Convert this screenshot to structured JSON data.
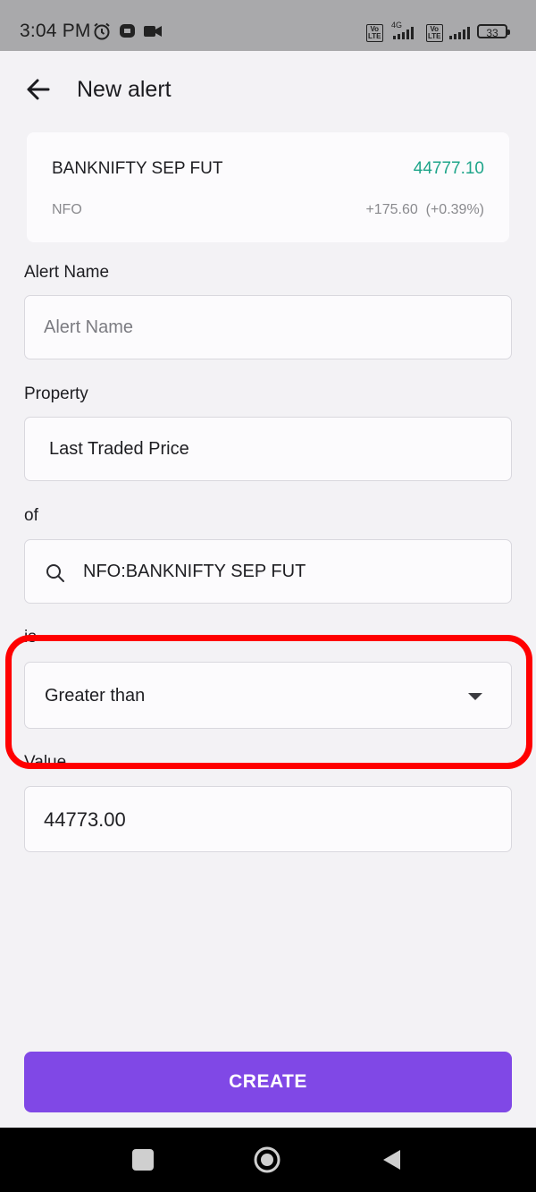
{
  "status_bar": {
    "time": "3:04 PM",
    "network": "4G",
    "volte_label": "Vo LTE",
    "battery": "33",
    "icons": [
      "alarm-icon",
      "message-icon",
      "video-icon",
      "volte-icon",
      "signal-icon",
      "battery-icon"
    ]
  },
  "header": {
    "title": "New alert",
    "back_icon": "arrow-left-icon"
  },
  "instrument": {
    "name": "BANKNIFTY SEP FUT",
    "exchange": "NFO",
    "ltp": "44777.10",
    "change": "+175.60  (+0.39%)",
    "ltp_color": "#1fa58a"
  },
  "form": {
    "alert_name": {
      "label": "Alert Name",
      "placeholder": "Alert Name",
      "value": ""
    },
    "property": {
      "label": "Property",
      "value": "Last Traded Price"
    },
    "of": {
      "label": "of",
      "value": "NFO:BANKNIFTY SEP FUT",
      "icon": "search-icon"
    },
    "is": {
      "label": "is",
      "value": "Greater than",
      "icon": "dropdown-arrow-icon"
    },
    "value": {
      "label": "Value",
      "value": "44773.00"
    }
  },
  "actions": {
    "create_label": "CREATE",
    "accent_color": "#8048e6"
  },
  "highlight_color": "#ff0000",
  "nav": {
    "icons": [
      "recents-square-icon",
      "home-circle-icon",
      "back-triangle-icon"
    ]
  }
}
